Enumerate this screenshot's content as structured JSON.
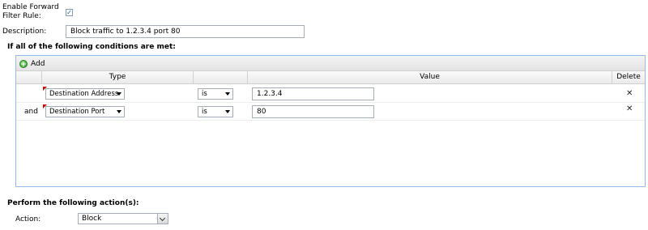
{
  "form": {
    "enable_label_line1": "Enable Forward",
    "enable_label_line2": "Filter Rule:",
    "enable_checked": true,
    "description_label": "Description:",
    "description_value": "Block traffic to 1.2.3.4 port 80"
  },
  "conditions": {
    "heading": "If all of the following conditions are met:",
    "add_label": "Add",
    "columns": {
      "type": "Type",
      "operator": "",
      "value": "Value",
      "delete": "Delete"
    },
    "rows": [
      {
        "conjunction": "",
        "type": "Destination Address",
        "operator": "is",
        "value": "1.2.3.4"
      },
      {
        "conjunction": "and",
        "type": "Destination Port",
        "operator": "is",
        "value": "80"
      }
    ]
  },
  "actions": {
    "heading": "Perform the following action(s):",
    "action_label": "Action:",
    "action_value": "Block"
  },
  "icons": {
    "add": "add-icon",
    "delete": "delete-icon",
    "checkbox": "checkmark-icon"
  },
  "colors": {
    "grid_border": "#99bbe8",
    "dirty_marker": "#cc0000",
    "add_icon": "#2f9b2a"
  }
}
